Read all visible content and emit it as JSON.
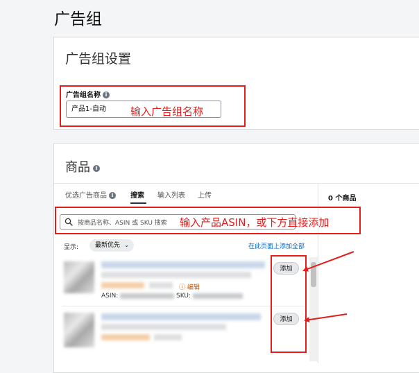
{
  "page": {
    "title": "广告组"
  },
  "settings": {
    "title": "广告组设置",
    "name_label": "广告组名称",
    "name_value": "产品1-自动"
  },
  "products": {
    "title": "商品",
    "tabs": [
      "优选广告商品",
      "搜索",
      "输入列表",
      "上传"
    ],
    "active_tab": "搜索",
    "count_label": "0 个商品",
    "search_placeholder": "按商品名称、ASIN 或 SKU 搜索",
    "show_label": "显示:",
    "sort_value": "最新优先",
    "add_all_label": "在此页面上添加全部",
    "items": [
      {
        "asin_label": "ASIN:",
        "sku_label": "SKU:",
        "edit_label": "编辑",
        "add_label": "添加"
      },
      {
        "add_label": "添加"
      }
    ]
  },
  "annotations": {
    "name_hint": "输入广告组名称",
    "search_hint": "输入产品ASIN，或下方直接添加",
    "color": "#e31c1c"
  }
}
